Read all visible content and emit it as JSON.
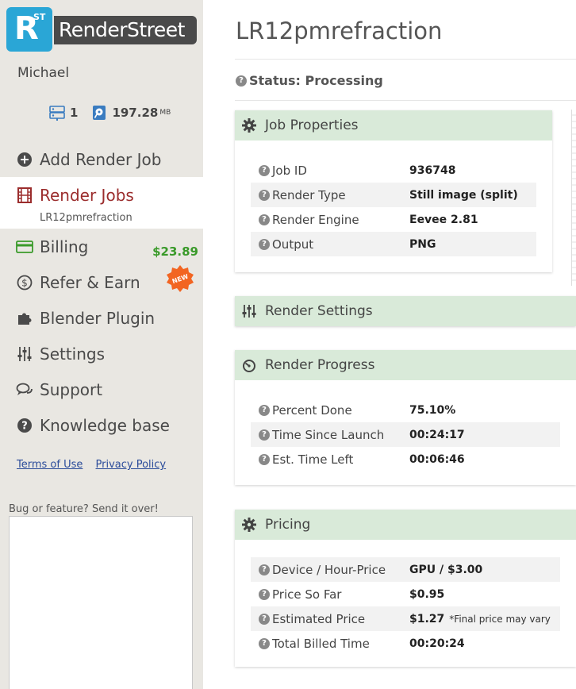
{
  "brand": {
    "logo_letter": "R",
    "logo_super": "ST",
    "name": "RenderStreet"
  },
  "user": {
    "name": "Michael"
  },
  "stats": {
    "servers": "1",
    "storage_value": "197.28",
    "storage_unit": "MB"
  },
  "nav": {
    "add_render_job": "Add Render Job",
    "render_jobs": "Render Jobs",
    "render_jobs_sub": "LR12pmrefraction",
    "billing": "Billing",
    "billing_amount": "$23.89",
    "refer_earn": "Refer & Earn",
    "new_badge": "NEW",
    "blender_plugin": "Blender Plugin",
    "settings": "Settings",
    "support": "Support",
    "knowledge_base": "Knowledge base"
  },
  "links": {
    "terms": "Terms of Use",
    "privacy": "Privacy Policy"
  },
  "feedback": {
    "label": "Bug or feature? Send it over!"
  },
  "page": {
    "title": "LR12pmrefraction",
    "status": "Status: Processing"
  },
  "job_properties": {
    "title": "Job Properties",
    "rows": [
      {
        "label": "Job ID",
        "value": "936748"
      },
      {
        "label": "Render Type",
        "value": "Still image (split)"
      },
      {
        "label": "Render Engine",
        "value": "Eevee 2.81"
      },
      {
        "label": "Output",
        "value": "PNG"
      }
    ]
  },
  "render_settings": {
    "title": "Render Settings"
  },
  "render_progress": {
    "title": "Render Progress",
    "rows": [
      {
        "label": "Percent Done",
        "value": "75.10%"
      },
      {
        "label": "Time Since Launch",
        "value": "00:24:17"
      },
      {
        "label": "Est. Time Left",
        "value": "00:06:46"
      }
    ]
  },
  "pricing": {
    "title": "Pricing",
    "rows": [
      {
        "label": "Device / Hour-Price",
        "value": "GPU / $3.00"
      },
      {
        "label": "Price So Far",
        "value": "$0.95"
      },
      {
        "label": "Estimated Price",
        "value": "$1.27",
        "note": "*Final price may vary"
      },
      {
        "label": "Total Billed Time",
        "value": "00:20:24"
      }
    ]
  },
  "colors": {
    "accent_blue": "#2aa6d6",
    "active_red": "#9b2d2d",
    "panel_header": "#d9ead9",
    "billing_green": "#3a9a2a",
    "new_badge": "#f26522"
  }
}
